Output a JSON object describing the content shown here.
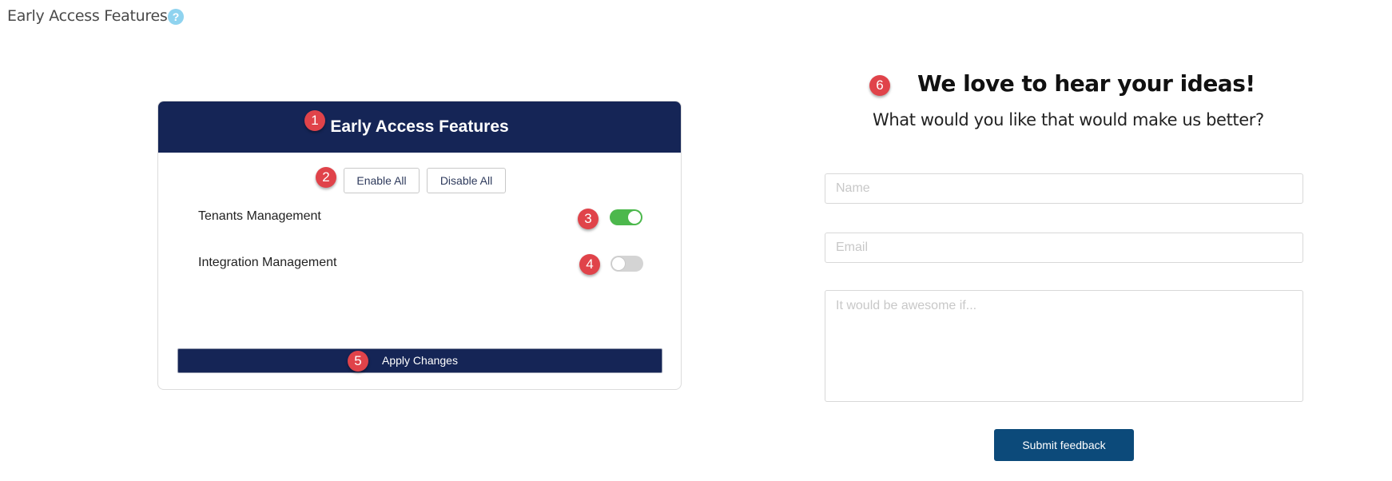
{
  "page": {
    "title": "Early Access Features",
    "help_icon": "question-circle-icon"
  },
  "annotations": [
    "1",
    "2",
    "3",
    "4",
    "5",
    "6"
  ],
  "features_card": {
    "title": "Early Access Features",
    "enable_all_label": "Enable All",
    "disable_all_label": "Disable All",
    "features": [
      {
        "label": "Tenants Management",
        "enabled": true
      },
      {
        "label": "Integration Management",
        "enabled": false
      }
    ],
    "apply_label": "Apply Changes"
  },
  "feedback": {
    "heading": "We love to hear your ideas!",
    "subheading": "What would you like that would make us better?",
    "name_placeholder": "Name",
    "name_value": "",
    "email_placeholder": "Email",
    "email_value": "",
    "message_placeholder": "It would be awesome if...",
    "message_value": "",
    "submit_label": "Submit feedback"
  },
  "colors": {
    "header_navy": "#152556",
    "toggle_on": "#4cb84c",
    "toggle_off": "#d4d4d4",
    "submit_blue": "#0c4a7a",
    "badge_red": "#e0434a",
    "help_icon": "#8fd3ef"
  }
}
